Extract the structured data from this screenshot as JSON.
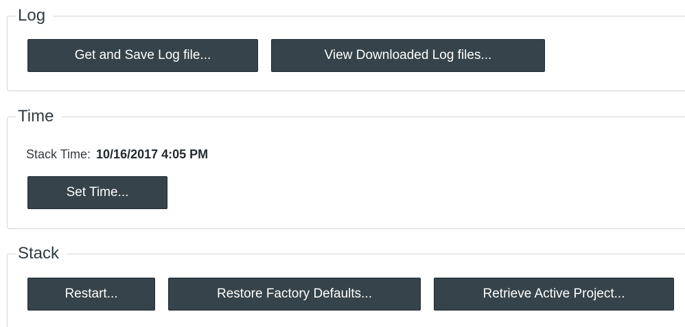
{
  "log": {
    "title": "Log",
    "get_save_button": "Get and Save Log file...",
    "view_downloaded_button": "View Downloaded Log files..."
  },
  "time": {
    "title": "Time",
    "stack_time_label": "Stack Time:",
    "stack_time_value": "10/16/2017 4:05 PM",
    "set_time_button": "Set Time..."
  },
  "stack": {
    "title": "Stack",
    "restart_button": "Restart...",
    "restore_defaults_button": "Restore Factory Defaults...",
    "retrieve_project_button": "Retrieve Active Project..."
  },
  "colors": {
    "button_bg": "#36434a",
    "button_text": "#ffffff",
    "group_border": "#d4d4d4"
  }
}
